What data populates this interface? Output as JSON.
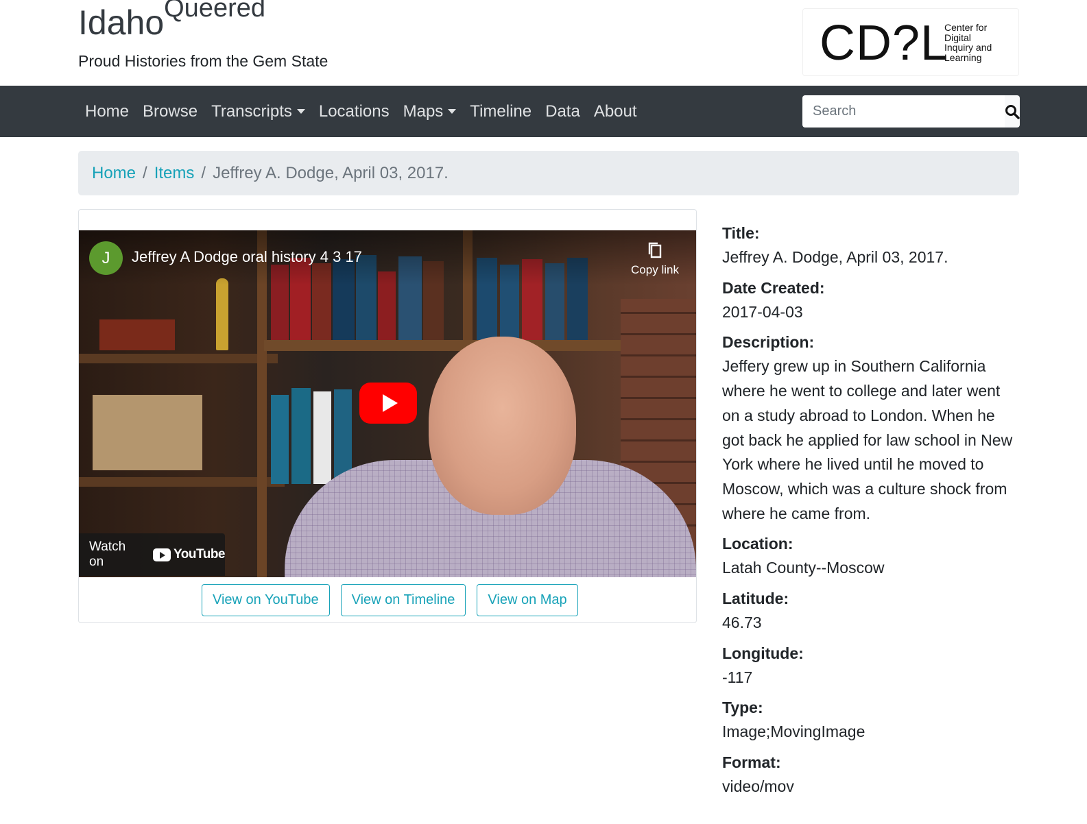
{
  "site": {
    "title": "Idaho",
    "title_sup": "Queered",
    "subtitle": "Proud Histories from the Gem State",
    "logo": {
      "mark": "CD?L",
      "text_lines": [
        "Center for",
        "Digital",
        "Inquiry and",
        "Learning"
      ]
    }
  },
  "nav": {
    "items": [
      {
        "label": "Home",
        "dropdown": false
      },
      {
        "label": "Browse",
        "dropdown": false
      },
      {
        "label": "Transcripts",
        "dropdown": true
      },
      {
        "label": "Locations",
        "dropdown": false
      },
      {
        "label": "Maps",
        "dropdown": true
      },
      {
        "label": "Timeline",
        "dropdown": false
      },
      {
        "label": "Data",
        "dropdown": false
      },
      {
        "label": "About",
        "dropdown": false
      }
    ],
    "search": {
      "placeholder": "Search",
      "icon": "search-icon"
    }
  },
  "breadcrumb": {
    "home": "Home",
    "items": "Items",
    "current": "Jeffrey A. Dodge, April 03, 2017."
  },
  "video": {
    "channel_initial": "J",
    "title": "Jeffrey A Dodge oral history 4 3 17",
    "copy_link": "Copy link",
    "watch_on": "Watch on",
    "youtube": "YouTube"
  },
  "buttons": {
    "youtube": "View on YouTube",
    "timeline": "View on Timeline",
    "map": "View on Map"
  },
  "metadata": {
    "title_label": "Title:",
    "title_value": "Jeffrey A. Dodge, April 03, 2017.",
    "date_label": "Date Created:",
    "date_value": "2017-04-03",
    "description_label": "Description:",
    "description_value": "Jeffery grew up in Southern California where he went to college and later went on a study abroad to London. When he got back he applied for law school in New York where he lived until he moved to Moscow, which was a culture shock from where he came from.",
    "location_label": "Location:",
    "location_value": "Latah County--Moscow",
    "latitude_label": "Latitude:",
    "latitude_value": "46.73",
    "longitude_label": "Longitude:",
    "longitude_value": "-117",
    "type_label": "Type:",
    "type_value": "Image;MovingImage",
    "format_label": "Format:",
    "format_value": "video/mov"
  },
  "colors": {
    "navbar": "#343a40",
    "accent": "#17a2b8",
    "breadcrumb_bg": "#e9ecef",
    "play_button": "#ff0000"
  }
}
